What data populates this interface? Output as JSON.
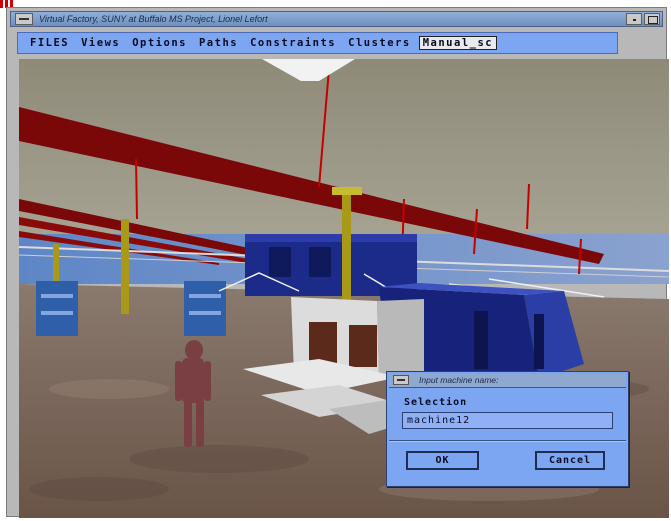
{
  "window": {
    "title": "Virtual Factory, SUNY at Buffalo  MS Project, Lionel Lefort"
  },
  "menubar": {
    "items": [
      {
        "label": "FILES"
      },
      {
        "label": "Views"
      },
      {
        "label": "Options"
      },
      {
        "label": "Paths"
      },
      {
        "label": "Constraints"
      },
      {
        "label": "Clusters"
      },
      {
        "label": "Manual_sc"
      }
    ]
  },
  "dialog": {
    "title": "Input machine name:",
    "selection_label": "Selection",
    "input_value": "machine12",
    "ok_label": "OK",
    "cancel_label": "Cancel"
  },
  "colors": {
    "menubar_bg": "#7da6f2",
    "beam_red": "#8a0a0a",
    "machine_blue": "#1c2a8a"
  },
  "icons": [
    "window-menu-icon",
    "minimize-icon",
    "maximize-icon"
  ]
}
